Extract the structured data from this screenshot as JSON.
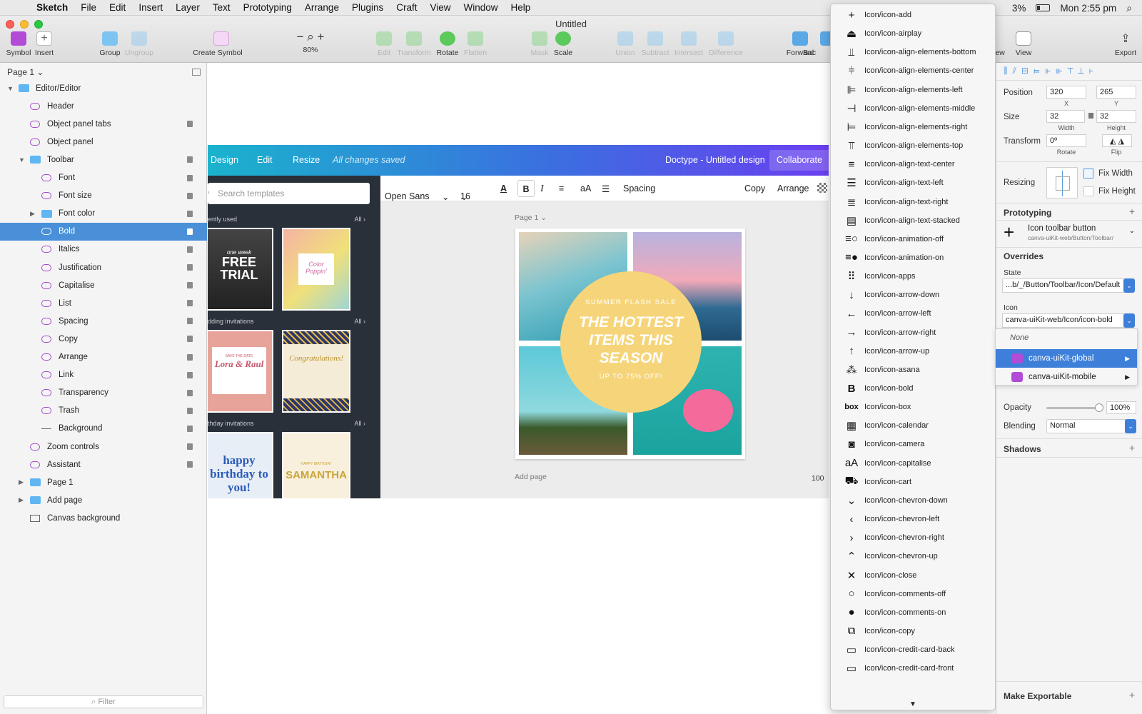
{
  "menubar": {
    "app": "Sketch",
    "items": [
      "File",
      "Edit",
      "Insert",
      "Layer",
      "Text",
      "Prototyping",
      "Arrange",
      "Plugins",
      "Craft",
      "View",
      "Window",
      "Help"
    ],
    "battery": "3%",
    "clock": "Mon 2:55 pm"
  },
  "window": {
    "title": "Untitled"
  },
  "toolbar": {
    "symbol": "Symbol",
    "insert": "Insert",
    "group": "Group",
    "ungroup": "Ungroup",
    "create_symbol": "Create Symbol",
    "zoom": "80%",
    "edit": "Edit",
    "transform": "Transform",
    "rotate": "Rotate",
    "flatten": "Flatten",
    "mask": "Mask",
    "scale": "Scale",
    "union": "Union",
    "subtract": "Subtract",
    "intersect": "Intersect",
    "difference": "Difference",
    "forward": "Forward",
    "backward": "Bac",
    "view_left": "iew",
    "view": "View",
    "export": "Export"
  },
  "layers": {
    "page_selector": "Page 1",
    "filter_placeholder": "Filter",
    "rows": [
      {
        "label": "Editor/Editor",
        "kind": "folder",
        "indent": 0,
        "tri": "open"
      },
      {
        "label": "Header",
        "kind": "symbol",
        "indent": 1
      },
      {
        "label": "Object panel tabs",
        "kind": "symbol",
        "indent": 1,
        "lock": true
      },
      {
        "label": "Object panel",
        "kind": "symbol",
        "indent": 1
      },
      {
        "label": "Toolbar",
        "kind": "folder",
        "indent": 1,
        "tri": "open",
        "lock": true
      },
      {
        "label": "Font",
        "kind": "symbol",
        "indent": 2,
        "lock": true
      },
      {
        "label": "Font size",
        "kind": "symbol",
        "indent": 2,
        "lock": true
      },
      {
        "label": "Font color",
        "kind": "folder",
        "indent": 2,
        "tri": "closed",
        "lock": true
      },
      {
        "label": "Bold",
        "kind": "symbol",
        "indent": 2,
        "lock": true,
        "selected": true
      },
      {
        "label": "Italics",
        "kind": "symbol",
        "indent": 2,
        "lock": true
      },
      {
        "label": "Justification",
        "kind": "symbol",
        "indent": 2,
        "lock": true
      },
      {
        "label": "Capitalise",
        "kind": "symbol",
        "indent": 2,
        "lock": true
      },
      {
        "label": "List",
        "kind": "symbol",
        "indent": 2,
        "lock": true
      },
      {
        "label": "Spacing",
        "kind": "symbol",
        "indent": 2,
        "lock": true
      },
      {
        "label": "Copy",
        "kind": "symbol",
        "indent": 2,
        "lock": true
      },
      {
        "label": "Arrange",
        "kind": "symbol",
        "indent": 2,
        "lock": true
      },
      {
        "label": "Link",
        "kind": "symbol",
        "indent": 2,
        "lock": true
      },
      {
        "label": "Transparency",
        "kind": "symbol",
        "indent": 2,
        "lock": true
      },
      {
        "label": "Trash",
        "kind": "symbol",
        "indent": 2,
        "lock": true
      },
      {
        "label": "Background",
        "kind": "line",
        "indent": 2,
        "lock": true
      },
      {
        "label": "Zoom controls",
        "kind": "symbol",
        "indent": 1,
        "lock": true
      },
      {
        "label": "Assistant",
        "kind": "symbol",
        "indent": 1,
        "lock": true
      },
      {
        "label": "Page 1",
        "kind": "folder",
        "indent": 1,
        "tri": "closed"
      },
      {
        "label": "Add page",
        "kind": "folder",
        "indent": 1,
        "tri": "closed"
      },
      {
        "label": "Canvas background",
        "kind": "rect",
        "indent": 1
      }
    ]
  },
  "canva": {
    "header": {
      "design": "Design",
      "edit": "Edit",
      "resize": "Resize",
      "saved": "All changes saved",
      "doc_title": "Doctype - Untitled design",
      "collaborate": "Collaborate"
    },
    "search_placeholder": "Search templates",
    "sections": [
      {
        "title": "ently used",
        "all": "All"
      },
      {
        "title": "dding invitations",
        "all": "All"
      },
      {
        "title": "thday invitations",
        "all": "All"
      }
    ],
    "thumb_text": {
      "free_trial": "FREE TRIAL",
      "one_week": "one week",
      "color": "Color Poppin'",
      "lora": "Lora & Raul",
      "save_date": "SAVE THE DATE",
      "congrats": "Congratulations!",
      "happy": "happy birthday to you!",
      "samantha": "SAMANTHA",
      "happy_bday": "HAPPY BIRTHDAY"
    },
    "options": {
      "font": "Open Sans",
      "size": "16",
      "spacing": "Spacing",
      "copy": "Copy",
      "arrange": "Arrange"
    },
    "page_label": "Page 1",
    "add_page": "Add page",
    "zoom": "100",
    "design": {
      "sale": "SUMMER FLASH SALE",
      "headline": "THE HOTTEST ITEMS THIS SEASON",
      "off": "UP TO 75% OFF!"
    }
  },
  "menu": {
    "items": [
      {
        "label": "Icon/icon-add",
        "icon": "plus-icon"
      },
      {
        "label": "Icon/icon-airplay",
        "icon": "airplay-icon"
      },
      {
        "label": "Icon/icon-align-elements-bottom",
        "icon": "align-bottom-icon"
      },
      {
        "label": "Icon/icon-align-elements-center",
        "icon": "align-center-icon"
      },
      {
        "label": "Icon/icon-align-elements-left",
        "icon": "align-left-icon"
      },
      {
        "label": "Icon/icon-align-elements-middle",
        "icon": "align-middle-icon"
      },
      {
        "label": "Icon/icon-align-elements-right",
        "icon": "align-right-icon"
      },
      {
        "label": "Icon/icon-align-elements-top",
        "icon": "align-top-icon"
      },
      {
        "label": "Icon/icon-align-text-center",
        "icon": "text-center-icon"
      },
      {
        "label": "Icon/icon-align-text-left",
        "icon": "text-left-icon"
      },
      {
        "label": "Icon/icon-align-text-right",
        "icon": "text-right-icon"
      },
      {
        "label": "Icon/icon-align-text-stacked",
        "icon": "text-stacked-icon"
      },
      {
        "label": "Icon/icon-animation-off",
        "icon": "animation-off-icon"
      },
      {
        "label": "Icon/icon-animation-on",
        "icon": "animation-on-icon"
      },
      {
        "label": "Icon/icon-apps",
        "icon": "apps-icon"
      },
      {
        "label": "Icon/icon-arrow-down",
        "icon": "arrow-down-icon"
      },
      {
        "label": "Icon/icon-arrow-left",
        "icon": "arrow-left-icon"
      },
      {
        "label": "Icon/icon-arrow-right",
        "icon": "arrow-right-icon"
      },
      {
        "label": "Icon/icon-arrow-up",
        "icon": "arrow-up-icon"
      },
      {
        "label": "Icon/icon-asana",
        "icon": "asana-icon"
      },
      {
        "label": "Icon/icon-bold",
        "icon": "bold-icon"
      },
      {
        "label": "Icon/icon-box",
        "icon": "box-icon"
      },
      {
        "label": "Icon/icon-calendar",
        "icon": "calendar-icon"
      },
      {
        "label": "Icon/icon-camera",
        "icon": "camera-icon"
      },
      {
        "label": "Icon/icon-capitalise",
        "icon": "capitalise-icon"
      },
      {
        "label": "Icon/icon-cart",
        "icon": "cart-icon"
      },
      {
        "label": "Icon/icon-chevron-down",
        "icon": "chevron-down-icon"
      },
      {
        "label": "Icon/icon-chevron-left",
        "icon": "chevron-left-icon"
      },
      {
        "label": "Icon/icon-chevron-right",
        "icon": "chevron-right-icon"
      },
      {
        "label": "Icon/icon-chevron-up",
        "icon": "chevron-up-icon"
      },
      {
        "label": "Icon/icon-close",
        "icon": "close-icon"
      },
      {
        "label": "Icon/icon-comments-off",
        "icon": "comments-off-icon"
      },
      {
        "label": "Icon/icon-comments-on",
        "icon": "comments-on-icon"
      },
      {
        "label": "Icon/icon-copy",
        "icon": "copy-icon"
      },
      {
        "label": "Icon/icon-credit-card-back",
        "icon": "credit-card-back-icon"
      },
      {
        "label": "Icon/icon-credit-card-front",
        "icon": "credit-card-front-icon"
      }
    ]
  },
  "inspector": {
    "position_label": "Position",
    "x": "320",
    "y": "265",
    "x_label": "X",
    "y_label": "Y",
    "size_label": "Size",
    "width": "32",
    "height": "32",
    "width_label": "Width",
    "height_label": "Height",
    "transform_label": "Transform",
    "rotate_value": "0º",
    "rotate_label": "Rotate",
    "flip_label": "Flip",
    "resizing_label": "Resizing",
    "fix_width": "Fix Width",
    "fix_height": "Fix Height",
    "prototyping": "Prototyping",
    "symbol_name": "Icon toolbar button",
    "symbol_path": "canva-uiKit-web/Button/Toolbar/",
    "overrides": "Overrides",
    "state_label": "State",
    "state_value": "...b/_/Button/Toolbar/Icon/Default",
    "icon_label": "Icon",
    "icon_value": "canva-uiKit-web/Icon/icon-bold",
    "opt_none": "None",
    "opt_global": "canva-uiKit-global",
    "opt_mobile": "canva-uiKit-mobile",
    "opacity_label": "Opacity",
    "opacity_value": "100%",
    "opacity_level": 1.0,
    "blending_label": "Blending",
    "blending_value": "Normal",
    "shadows": "Shadows",
    "make_exportable": "Make Exportable"
  },
  "colors": {
    "selection": "#4a90d9",
    "symbol": "#a64bc9",
    "folder": "#5fb6f2",
    "menu_highlight": "#3d7fd9",
    "dark_panel": "#293039"
  }
}
